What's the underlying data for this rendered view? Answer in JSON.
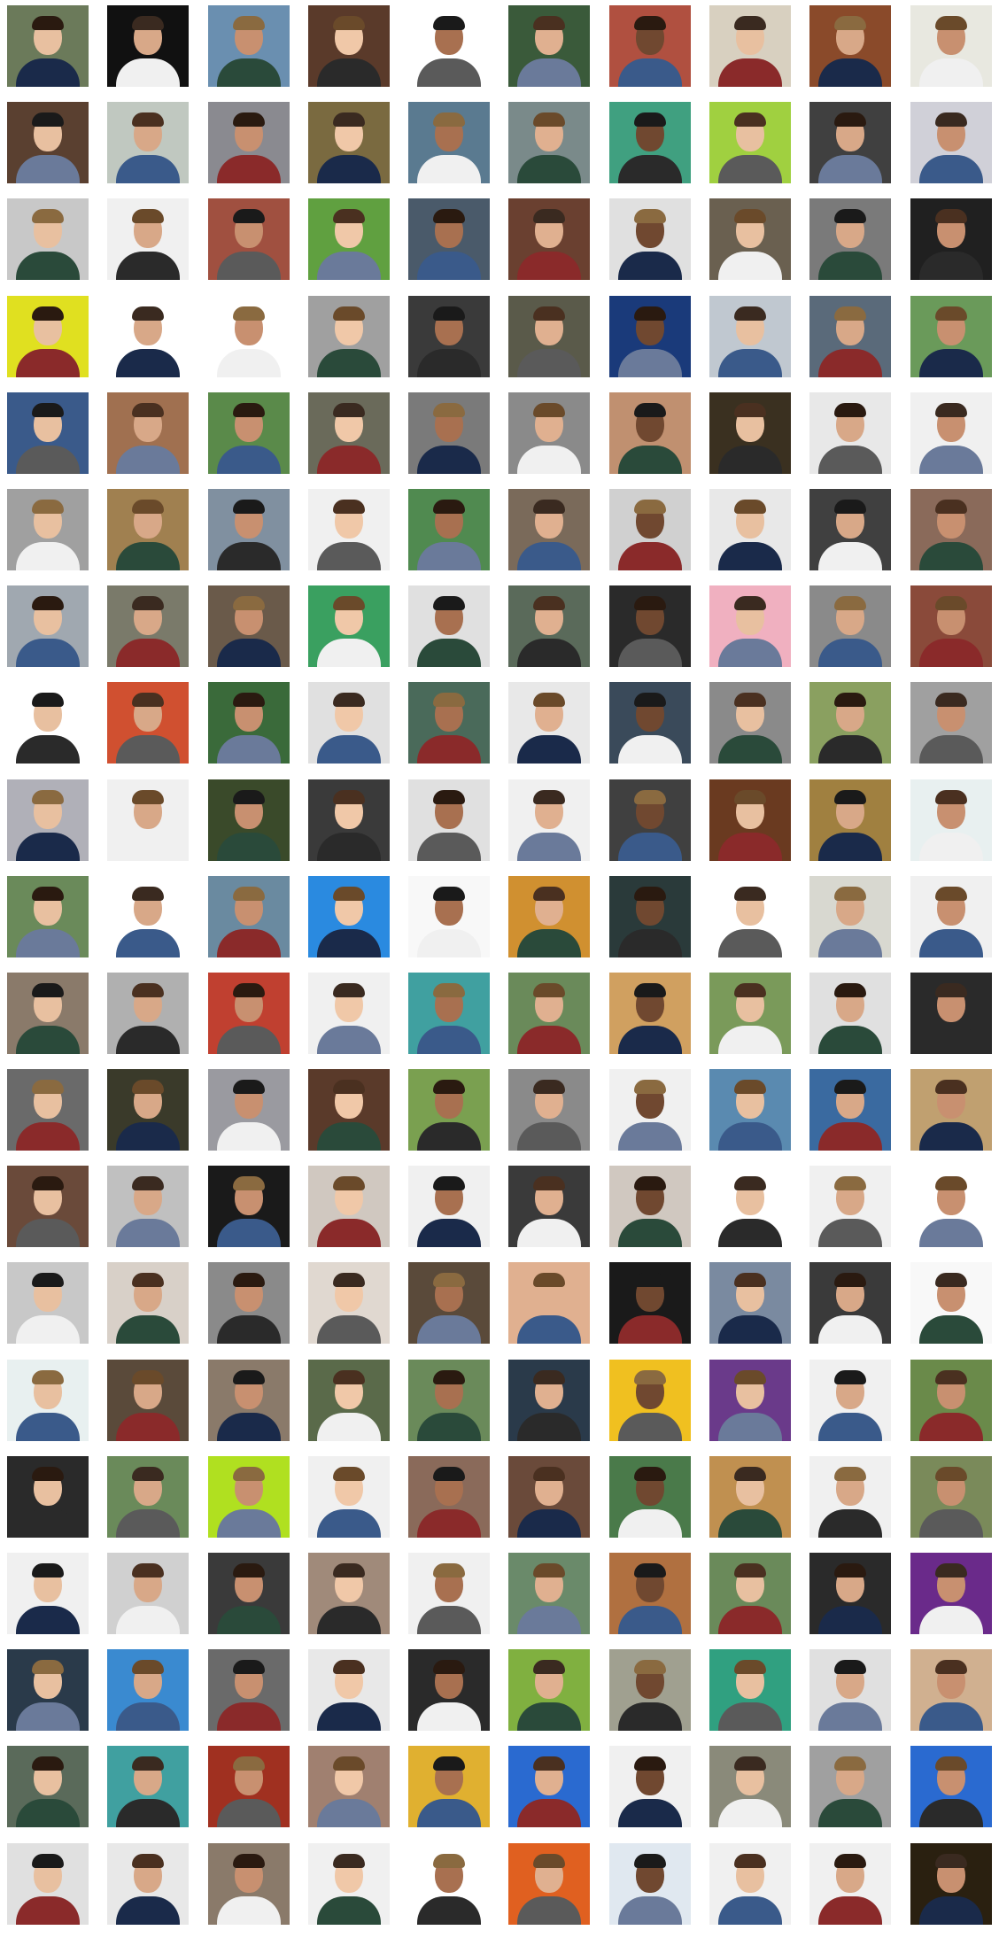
{
  "gallery": {
    "rows": [
      [
        "#6b7a5a",
        "#111111",
        "#6a8fb0",
        "#5a3a2a",
        "#ffffff",
        "#3a5a3a",
        "#b05040",
        "#d8d0c0",
        "#8a4a2a",
        "#e8e8e0"
      ],
      [
        "#5a4030",
        "#c0c8c0",
        "#8a8a90",
        "#7a6a40",
        "#5a7a90",
        "#7a8a8a",
        "#40a080",
        "#a0d040",
        "#404040",
        "#d0d0d8"
      ],
      [
        "#c8c8c8",
        "#f0f0f0",
        "#a05040",
        "#60a040",
        "#4a5a6a",
        "#6a4030",
        "#e0e0e0",
        "#6a6050",
        "#7a7a7a",
        "#202020"
      ],
      [
        "#e0e020",
        "#ffffff",
        "#ffffff",
        "#a0a0a0",
        "#3a3a3a",
        "#5a5a4a",
        "#1a3a7a",
        "#c0c8d0",
        "#5a6a7a",
        "#6a9a5a"
      ],
      [
        "#3a5a8a",
        "#a07050",
        "#5a8a4a",
        "#6a6a5a",
        "#7a7a7a",
        "#8a8a8a",
        "#c09070",
        "#3a3020",
        "#e8e8e8",
        "#f0f0f0"
      ],
      [
        "#a0a0a0",
        "#a08050",
        "#8090a0",
        "#f0f0f0",
        "#508a50",
        "#7a6a5a",
        "#d0d0d0",
        "#e8e8e8",
        "#404040",
        "#8a6a5a"
      ],
      [
        "#a0a8b0",
        "#7a7a6a",
        "#6a5a4a",
        "#3aa060",
        "#e0e0e0",
        "#5a6a5a",
        "#2a2a2a",
        "#f0b0c0",
        "#8a8a8a",
        "#8a4a3a"
      ],
      [
        "#ffffff",
        "#d05030",
        "#3a6a3a",
        "#e0e0e0",
        "#4a6a5a",
        "#e8e8e8",
        "#3a4a5a",
        "#8a8a8a",
        "#8aa060",
        "#a0a0a0"
      ],
      [
        "#b0b0b8",
        "#f0f0f0",
        "#3a4a2a",
        "#3a3a3a",
        "#e0e0e0",
        "#f0f0f0",
        "#404040",
        "#6a3a20",
        "#a08040",
        "#e8f0f0"
      ],
      [
        "#6a8a5a",
        "#ffffff",
        "#6a8aa0",
        "#2a8ae0",
        "#f8f8f8",
        "#d09030",
        "#2a3a3a",
        "#ffffff",
        "#d8d8d0",
        "#f0f0f0"
      ],
      [
        "#8a7a6a",
        "#b0b0b0",
        "#c04030",
        "#f0f0f0",
        "#40a0a0",
        "#6a8a5a",
        "#d0a060",
        "#7a9a5a",
        "#e0e0e0",
        "#2a2a2a"
      ],
      [
        "#6a6a6a",
        "#3a3a2a",
        "#9a9aa0",
        "#5a3a2a",
        "#7aa050",
        "#8a8a8a",
        "#f0f0f0",
        "#5a8ab0",
        "#3a6aa0",
        "#c0a070"
      ],
      [
        "#6a4a3a",
        "#c0c0c0",
        "#1a1a1a",
        "#d0c8c0",
        "#f0f0f0",
        "#3a3a3a",
        "#d0c8c0",
        "#ffffff",
        "#f0f0f0",
        "#ffffff"
      ],
      [
        "#c8c8c8",
        "#d8d0c8",
        "#8a8a8a",
        "#e0d8d0",
        "#5a4a3a",
        "#e0b090",
        "#1a1a1a",
        "#7a8aa0",
        "#3a3a3a",
        "#f8f8f8"
      ],
      [
        "#e8f0f0",
        "#5a4a3a",
        "#8a7a6a",
        "#5a6a4a",
        "#6a8a5a",
        "#2a3a4a",
        "#f0c020",
        "#6a3a8a",
        "#f0f0f0",
        "#6a8a4a"
      ],
      [
        "#2a2a2a",
        "#6a8a5a",
        "#b0e020",
        "#f0f0f0",
        "#8a6a5a",
        "#6a4a3a",
        "#4a7a4a",
        "#c09050",
        "#f0f0f0",
        "#7a8a5a"
      ],
      [
        "#f0f0f0",
        "#d0d0d0",
        "#3a3a3a",
        "#a08a7a",
        "#f0f0f0",
        "#6a8a6a",
        "#b07040",
        "#6a8a5a",
        "#2a2a2a",
        "#6a2a8a"
      ],
      [
        "#2a3a4a",
        "#3a8ad0",
        "#6a6a6a",
        "#e8e8e8",
        "#2a2a2a",
        "#80b040",
        "#a0a090",
        "#30a080",
        "#e0e0e0",
        "#d0b090"
      ],
      [
        "#5a6a5a",
        "#40a0a0",
        "#a03020",
        "#a08070",
        "#e0b030",
        "#2a6ad0",
        "#f0f0f0",
        "#8a8a7a",
        "#a0a0a0",
        "#2a6ad0"
      ],
      [
        "#e0e0e0",
        "#e8e8e8",
        "#8a7a6a",
        "#f0f0f0",
        "#ffffff",
        "#e06020",
        "#e0e8f0",
        "#f0f0f0",
        "#f0f0f0",
        "#2a2010"
      ]
    ]
  }
}
